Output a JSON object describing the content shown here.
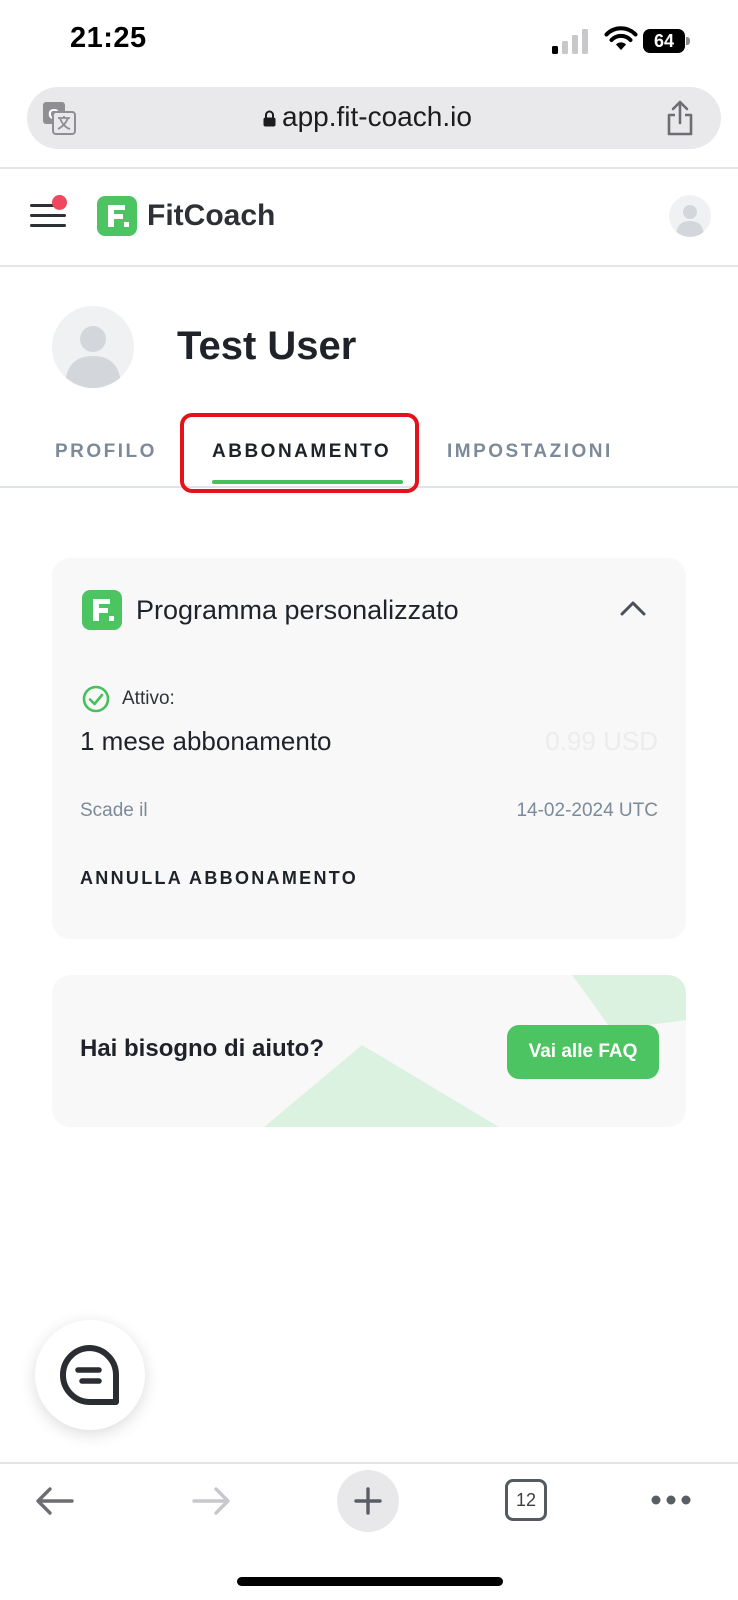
{
  "status_bar": {
    "time": "21:25",
    "battery": "64"
  },
  "browser": {
    "url": "app.fit-coach.io",
    "tabs_count": "12"
  },
  "header": {
    "brand": "FitCoach",
    "logo_letter": "F."
  },
  "profile": {
    "name": "Test User"
  },
  "tabs": [
    {
      "label": "PROFILO",
      "active": false
    },
    {
      "label": "ABBONAMENTO",
      "active": true
    },
    {
      "label": "IMPOSTAZIONI",
      "active": false
    }
  ],
  "subscription": {
    "title": "Programma personalizzato",
    "status": "Attivo:",
    "plan": "1 mese abbonamento",
    "price": "0.99 USD",
    "expiry_label": "Scade il",
    "expiry_value": "14-02-2024 UTC",
    "cancel_label": "ANNULLA ABBONAMENTO"
  },
  "help": {
    "text": "Hai bisogno di aiuto?",
    "button": "Vai alle FAQ"
  },
  "colors": {
    "accent_green": "#45c05a",
    "highlight_red": "#e5121b",
    "notification_dot": "#f0465e"
  },
  "icons": [
    "translate-icon",
    "lock-icon",
    "share-icon",
    "menu-icon",
    "avatar-icon",
    "chevron-up-icon",
    "check-circle-icon",
    "chat-icon",
    "back-arrow-icon",
    "forward-arrow-icon",
    "plus-icon",
    "more-icon"
  ]
}
